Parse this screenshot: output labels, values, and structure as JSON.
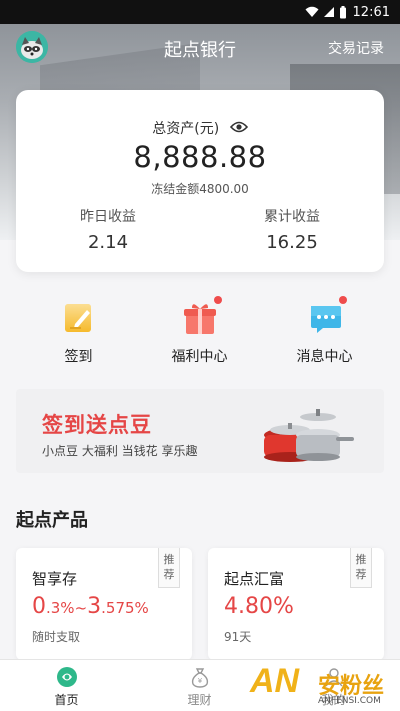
{
  "status_bar": {
    "time": "12:61"
  },
  "nav": {
    "title": "起点银行",
    "right_link": "交易记录"
  },
  "assets": {
    "label": "总资产(元)",
    "total": "8,888.88",
    "frozen": "冻结金额4800.00",
    "yesterday_label": "昨日收益",
    "yesterday_value": "2.14",
    "cumulative_label": "累计收益",
    "cumulative_value": "16.25"
  },
  "quick_actions": [
    {
      "label": "签到",
      "icon": "pencil-note-icon",
      "badge": false
    },
    {
      "label": "福利中心",
      "icon": "gift-icon",
      "badge": true
    },
    {
      "label": "消息中心",
      "icon": "message-icon",
      "badge": true
    }
  ],
  "banner": {
    "title": "签到送点豆",
    "subtitle": "小点豆 大福利 当钱花 享乐趣"
  },
  "products_section": {
    "title": "起点产品"
  },
  "products": [
    {
      "name": "智享存",
      "rate_parts": [
        "0",
        ".3%~",
        "3",
        ".575%"
      ],
      "note": "随时支取",
      "tag": "推荐"
    },
    {
      "name": "起点汇富",
      "rate": "4.80%",
      "note": "91天",
      "tag": "推荐"
    }
  ],
  "tabbar": {
    "tabs": [
      {
        "label": "首页",
        "icon": "home-icon",
        "active": true
      },
      {
        "label": "理财",
        "icon": "money-bag-icon",
        "active": false
      },
      {
        "label": "我的",
        "icon": "user-icon",
        "active": false
      }
    ]
  },
  "watermark": {
    "logo": "AN",
    "text": "安粉丝",
    "url": "ANFENSI.COM"
  },
  "colors": {
    "accent_red": "#e54646",
    "teal": "#3cb6a4"
  }
}
